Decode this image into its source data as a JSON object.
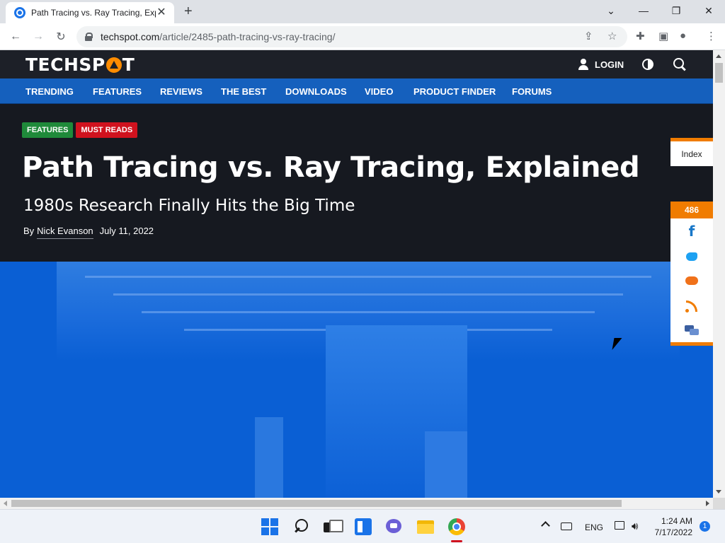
{
  "browser": {
    "tab_title": "Path Tracing vs. Ray Tracing, Expl",
    "new_tab_label": "+",
    "url_domain": "techspot.com",
    "url_path": "/article/2485-path-tracing-vs-ray-tracing/"
  },
  "site": {
    "logo_text_a": "TECHSP",
    "logo_text_b": "T",
    "login_label": "LOGIN",
    "nav": [
      "TRENDING",
      "FEATURES",
      "REVIEWS",
      "THE BEST",
      "DOWNLOADS",
      "VIDEO",
      "PRODUCT FINDER",
      "FORUMS"
    ]
  },
  "article": {
    "tags": [
      "FEATURES",
      "MUST READS"
    ],
    "title": "Path Tracing vs. Ray Tracing, Explained",
    "subtitle": "1980s Research Finally Hits the Big Time",
    "by_label": "By",
    "author": "Nick Evanson",
    "date": "July 11, 2022"
  },
  "sidebar": {
    "index_label": "Index",
    "share_count": "486",
    "share_icons": [
      "facebook-icon",
      "twitter-icon",
      "reddit-icon",
      "rss-icon",
      "comments-icon"
    ]
  },
  "taskbar": {
    "language": "ENG",
    "time": "1:24 AM",
    "date": "7/17/2022",
    "notification_count": "1"
  },
  "colors": {
    "brand_blue": "#1560bd",
    "accent_orange": "#f07c00",
    "tag_green": "#1f8a3a",
    "tag_red": "#d0121e",
    "header_dark": "#1d2028"
  }
}
